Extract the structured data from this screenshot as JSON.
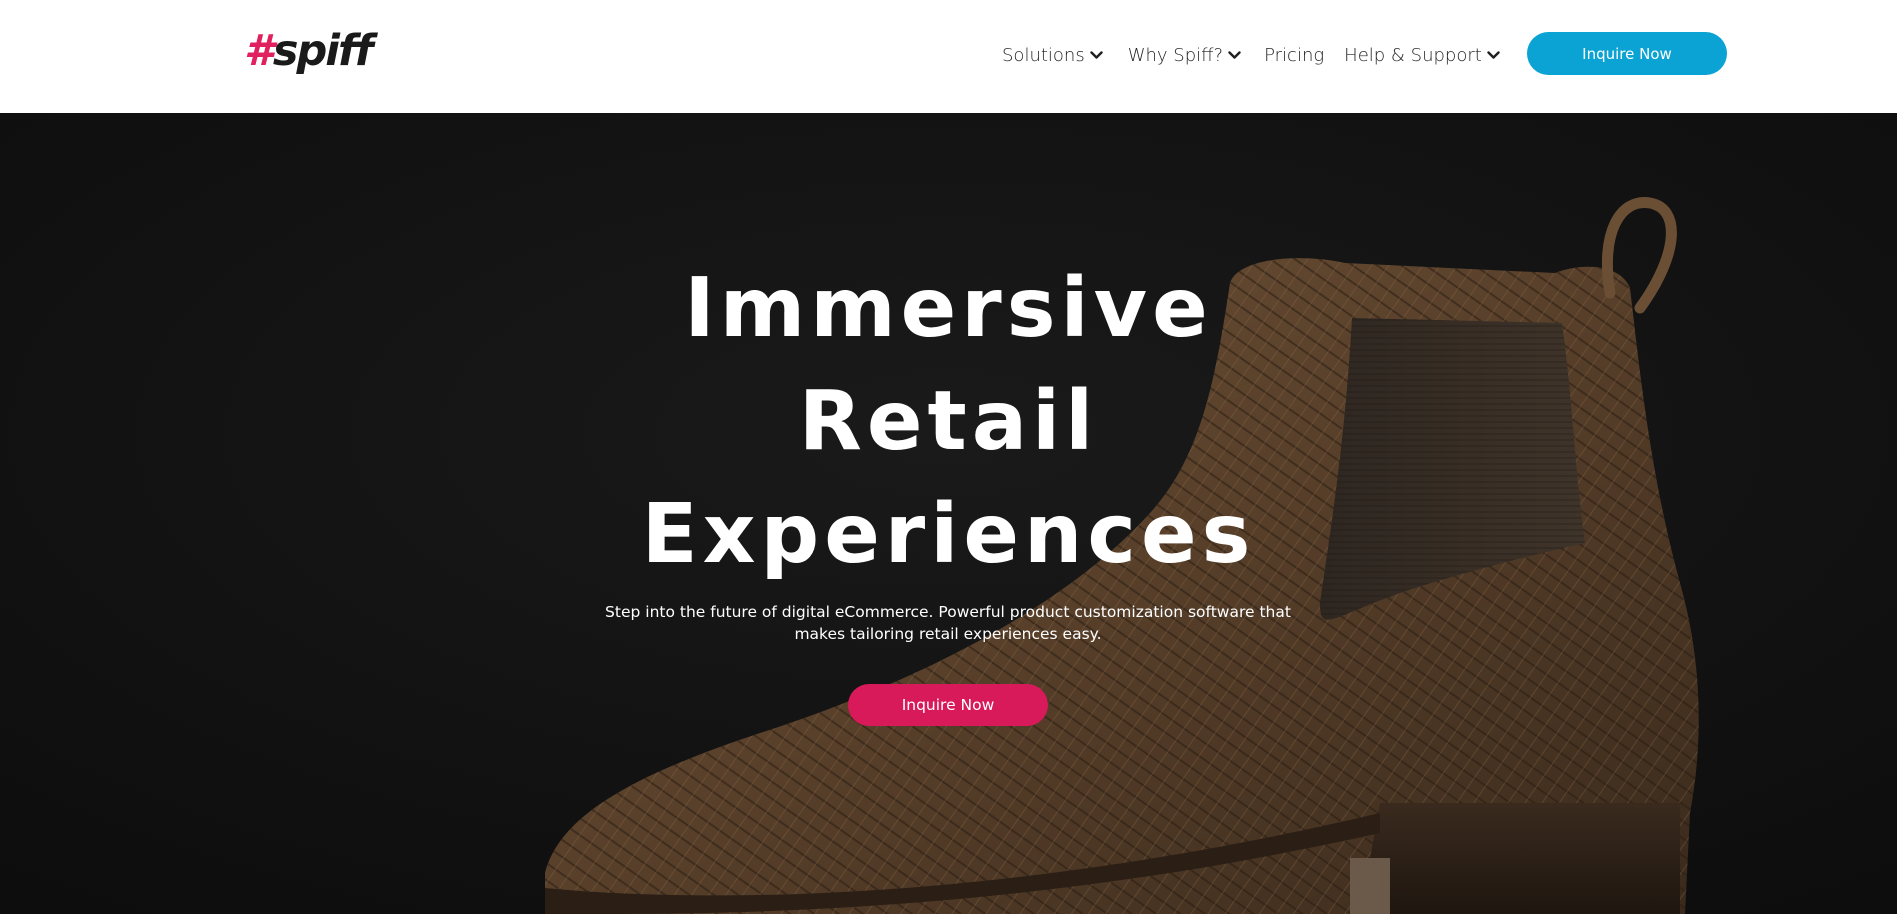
{
  "brand": {
    "logo_hash": "#",
    "logo_word": "spiff",
    "logo_hash_color": "#e0205f"
  },
  "nav": {
    "items": [
      {
        "label": "Solutions",
        "has_dropdown": true
      },
      {
        "label": "Why Spiff?",
        "has_dropdown": true
      },
      {
        "label": "Pricing",
        "has_dropdown": false
      },
      {
        "label": "Help & Support",
        "has_dropdown": true
      }
    ],
    "cta_label": "Inquire Now",
    "cta_color": "#0aa3d3"
  },
  "hero": {
    "title_lines": [
      "Immersive",
      "Retail",
      "Experiences"
    ],
    "subtitle": "Step into the future of digital eCommerce. Powerful product customization software that makes tailoring retail experiences easy.",
    "cta_label": "Inquire Now",
    "cta_color": "#d91a5a",
    "background_image": "brown-chelsea-boot-photo"
  }
}
